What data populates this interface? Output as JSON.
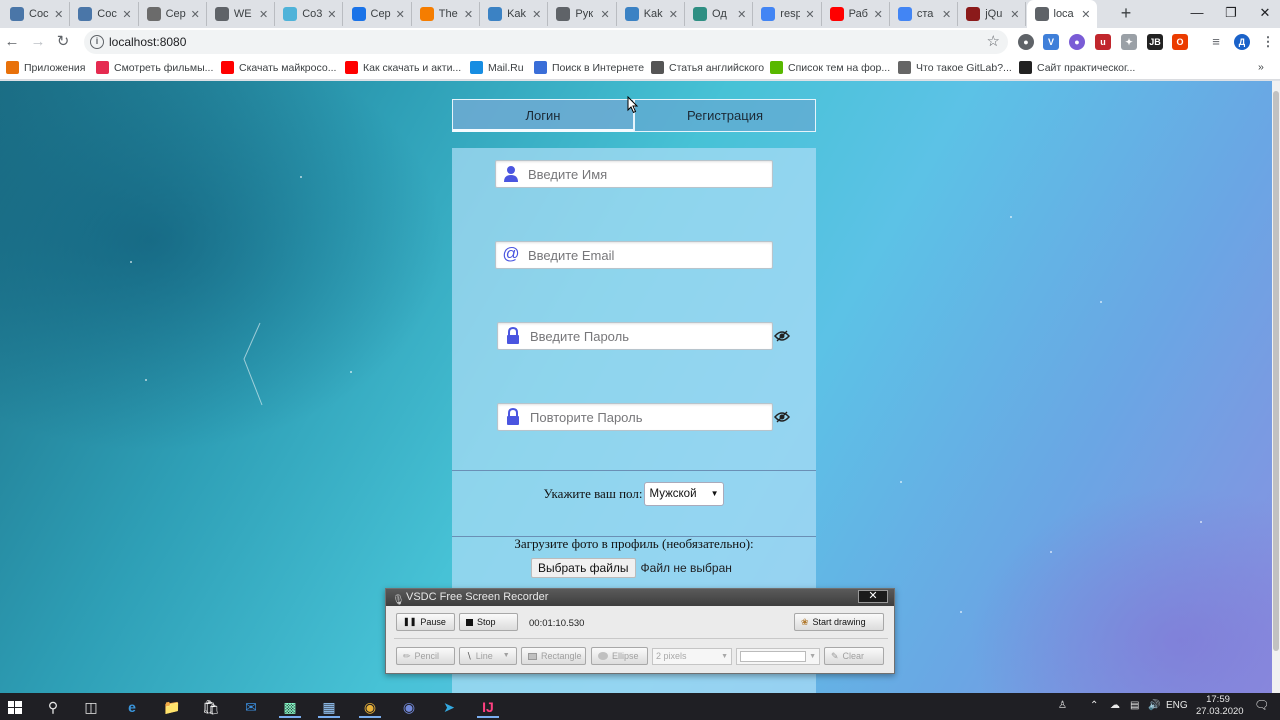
{
  "browser": {
    "tabs": [
      {
        "title": "Coc",
        "icon": "vk-icon",
        "color": "#4a76a8"
      },
      {
        "title": "Coc",
        "icon": "vk-icon",
        "color": "#4a76a8"
      },
      {
        "title": "Cep",
        "icon": "book-icon",
        "color": "#6b6b6b"
      },
      {
        "title": "WE",
        "icon": "globe-icon",
        "color": "#5f6368"
      },
      {
        "title": "Co3",
        "icon": "puzzle-icon",
        "color": "#4fb3d9"
      },
      {
        "title": "Cep",
        "icon": "chrome-icon",
        "color": "#1a73e8"
      },
      {
        "title": "The",
        "icon": "blogger-icon",
        "color": "#f57d00"
      },
      {
        "title": "Kak",
        "icon": "link-icon",
        "color": "#3b82c4"
      },
      {
        "title": "Рук",
        "icon": "globe-icon",
        "color": "#5f6368"
      },
      {
        "title": "Kak",
        "icon": "link-icon",
        "color": "#3b82c4"
      },
      {
        "title": "Од",
        "icon": "code-icon",
        "color": "#2f8f83"
      },
      {
        "title": "resp",
        "icon": "google-icon",
        "color": "#4285f4"
      },
      {
        "title": "Раб",
        "icon": "youtube-icon",
        "color": "#ff0000"
      },
      {
        "title": "ста",
        "icon": "google-icon",
        "color": "#4285f4"
      },
      {
        "title": "jQu",
        "icon": "r-icon",
        "color": "#8b1a1a"
      },
      {
        "title": "loca",
        "icon": "globe-icon",
        "color": "#5f6368"
      }
    ],
    "new_tab": "+",
    "url": "localhost:8080",
    "bookmarks": [
      {
        "label": "Приложения",
        "icon": "apps-grid-icon",
        "color": "#e8710a"
      },
      {
        "label": "Смотреть фильмы...",
        "icon": "ivi-icon",
        "color": "#e52b50"
      },
      {
        "label": "Скачать майкросо...",
        "icon": "youtube-icon",
        "color": "#ff0000"
      },
      {
        "label": "Как скачать и акти...",
        "icon": "youtube-icon",
        "color": "#ff0000"
      },
      {
        "label": "Mail.Ru",
        "icon": "mailru-icon",
        "color": "#168de2"
      },
      {
        "label": "Поиск в Интернете",
        "icon": "search-icon",
        "color": "#3a6ed8"
      },
      {
        "label": "Статья английского",
        "icon": "doc-icon",
        "color": "#555555"
      },
      {
        "label": "Список тем на фор...",
        "icon": "owl-icon",
        "color": "#58b800"
      },
      {
        "label": "Что такое GitLab?...",
        "icon": "tag-icon",
        "color": "#666666"
      },
      {
        "label": "Сайт практическог...",
        "icon": "rs-icon",
        "color": "#222222"
      }
    ]
  },
  "page": {
    "tabs": {
      "login": "Логин",
      "register": "Регистрация"
    },
    "fields": {
      "name_placeholder": "Введите Имя",
      "email_placeholder": "Введите Email",
      "password_placeholder": "Введите Пароль",
      "repeat_placeholder": "Повторите Пароль"
    },
    "gender": {
      "label": "Укажите ваш пол:",
      "value": "Мужской"
    },
    "upload": {
      "label": "Загрузите фото в профиль (необязательно):",
      "button": "Выбрать файлы",
      "status": "Файл не выбран"
    }
  },
  "recorder": {
    "title": "VSDC Free Screen Recorder",
    "close": "✕",
    "pause": "Pause",
    "stop": "Stop",
    "time": "00:01:10.530",
    "start_drawing": "Start drawing",
    "pencil": "Pencil",
    "line": "Line",
    "rectangle": "Rectangle",
    "ellipse": "Ellipse",
    "thickness": "2 pixels",
    "clear": "Clear"
  },
  "taskbar": {
    "lang": "ENG",
    "time": "17:59",
    "date": "27.03.2020"
  }
}
